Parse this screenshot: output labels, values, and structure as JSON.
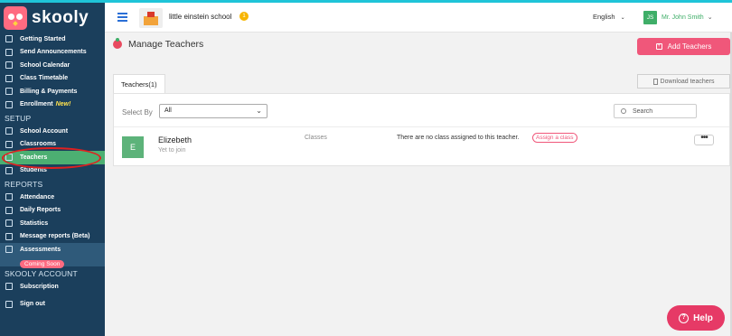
{
  "brand": {
    "name": "skooly"
  },
  "sidebar": {
    "items": [
      {
        "label": "Getting Started",
        "icon": "rocket-icon"
      },
      {
        "label": "Send Announcements",
        "icon": "send-icon"
      },
      {
        "label": "School Calendar",
        "icon": "calendar-icon"
      },
      {
        "label": "Class Timetable",
        "icon": "timetable-icon"
      },
      {
        "label": "Billing & Payments",
        "icon": "billing-icon"
      },
      {
        "label": "Enrollment",
        "icon": "enrollment-icon",
        "badge": "New!"
      }
    ],
    "setup_heading": "SETUP",
    "setup_items": [
      {
        "label": "School Account",
        "icon": "school-icon"
      },
      {
        "label": "Classrooms",
        "icon": "classroom-icon"
      },
      {
        "label": "Teachers",
        "icon": "teacher-icon",
        "active": true
      },
      {
        "label": "Students",
        "icon": "student-icon"
      }
    ],
    "reports_heading": "REPORTS",
    "reports_items": [
      {
        "label": "Attendance",
        "icon": "attendance-icon"
      },
      {
        "label": "Daily Reports",
        "icon": "daily-report-icon"
      },
      {
        "label": "Statistics",
        "icon": "statistics-icon"
      },
      {
        "label": "Message reports (Beta)",
        "icon": "message-report-icon"
      }
    ],
    "assessments": {
      "label": "Assessments",
      "badge": "Coming Soon"
    },
    "account_heading": "SKOOLY ACCOUNT",
    "account_items": [
      {
        "label": "Subscription",
        "icon": "subscription-icon"
      },
      {
        "label": "Sign out",
        "icon": "sign-out-icon"
      }
    ]
  },
  "topbar": {
    "school_name": "little einstein school",
    "school_badge": "1",
    "language": "English",
    "user_initials": "JS",
    "user_name": "Mr. John Smith"
  },
  "page": {
    "title": "Manage Teachers",
    "add_button": "Add Teachers",
    "tab_label": "Teachers(1)",
    "download_button": "Download teachers",
    "select_by_label": "Select By",
    "select_value": "All",
    "search_placeholder": "Search"
  },
  "teachers": [
    {
      "initial": "E",
      "name": "Elizebeth",
      "status": "Yet to join",
      "classes_label": "Classes",
      "classes_text": "There are no class assigned to this teacher.",
      "assign_label": "Assign a class",
      "more_label": "•••"
    }
  ],
  "help": {
    "label": "Help"
  },
  "colors": {
    "sidebar_bg": "#1b3f5c",
    "active_green": "#4caf72",
    "accent_pink": "#f0577a",
    "top_accent": "#1fc4d8"
  }
}
